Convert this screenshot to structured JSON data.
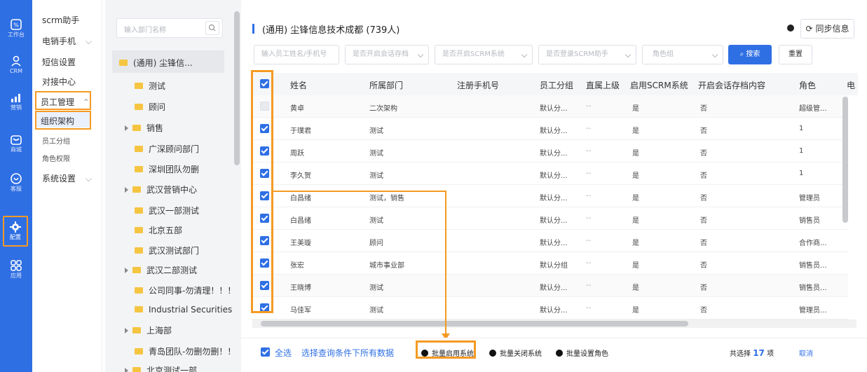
{
  "rail": {
    "items": [
      {
        "label": "工作台",
        "icon": "workbench-icon"
      },
      {
        "label": "CRM",
        "icon": "user-icon"
      },
      {
        "label": "营销",
        "icon": "marketing-icon"
      },
      {
        "label": "商城",
        "icon": "mall-icon"
      },
      {
        "label": "客服",
        "icon": "service-icon"
      },
      {
        "label": "配置",
        "icon": "gear-icon"
      },
      {
        "label": "应用",
        "icon": "apps-icon"
      }
    ]
  },
  "submenu": {
    "items": [
      "scrm助手",
      "电销手机",
      "短信设置",
      "对接中心",
      "员工管理",
      "组织架构",
      "员工分组",
      "角色权限",
      "系统设置"
    ]
  },
  "tree": {
    "search_placeholder": "输入部门名称",
    "root": "(通用) 尘锋信...",
    "nodes": [
      "测试",
      "顾问",
      "销售",
      "广深顾问部门",
      "深圳团队勿删",
      "武汉营销中心",
      "武汉一部测试",
      "北京五部",
      "武汉测试部门",
      "武汉二部测试",
      "公司同事-勿清理！！！",
      "Industrial Securities",
      "上海部",
      "青岛团队-勿删勿删！！",
      "北京测试一部"
    ]
  },
  "main": {
    "title": "(通用) 尘锋信息技术成都 (739人)",
    "sync_label": "同步信息",
    "filters": {
      "name_placeholder": "输入员工姓名/手机号",
      "archive": "是否开启会话存档",
      "scrm": "是否开启SCRM系统",
      "login": "是否登录SCRM助手",
      "role": "角色组"
    },
    "search_label": "搜索",
    "reset_label": "重置",
    "columns": [
      "姓名",
      "所属部门",
      "注册手机号",
      "员工分组",
      "直属上级",
      "启用SCRM系统",
      "开启会话存档内容",
      "角色",
      "电"
    ],
    "rows": [
      {
        "name": "黄卓",
        "dept": "二次架构",
        "group": "默认分...",
        "boss": "--",
        "scrm": "是",
        "archive": "否",
        "role": "超级管...",
        "checked": false
      },
      {
        "name": "于璞君",
        "dept": "测试",
        "group": "默认分...",
        "boss": "--",
        "scrm": "是",
        "archive": "否",
        "role": "1",
        "checked": true
      },
      {
        "name": "周跃",
        "dept": "测试",
        "group": "默认分...",
        "boss": "--",
        "scrm": "是",
        "archive": "否",
        "role": "1",
        "checked": true
      },
      {
        "name": "李久贺",
        "dept": "测试",
        "group": "默认分...",
        "boss": "--",
        "scrm": "是",
        "archive": "否",
        "role": "1",
        "checked": true
      },
      {
        "name": "白昌绪",
        "dept": "测试，销售",
        "group": "默认分...",
        "boss": "--",
        "scrm": "是",
        "archive": "否",
        "role": "管理员",
        "checked": true
      },
      {
        "name": "白昌绪",
        "dept": "测试",
        "group": "默认分...",
        "boss": "--",
        "scrm": "是",
        "archive": "否",
        "role": "销售员",
        "checked": true
      },
      {
        "name": "王美璇",
        "dept": "顾问",
        "group": "默认分...",
        "boss": "--",
        "scrm": "是",
        "archive": "否",
        "role": "合作商...",
        "checked": true
      },
      {
        "name": "张宏",
        "dept": "城市事业部",
        "group": "默认分组",
        "boss": "--",
        "scrm": "是",
        "archive": "否",
        "role": "销售员...",
        "checked": true
      },
      {
        "name": "王晓博",
        "dept": "测试",
        "group": "默认分...",
        "boss": "--",
        "scrm": "是",
        "archive": "否",
        "role": "销售员...",
        "checked": true
      },
      {
        "name": "马佳军",
        "dept": "测试",
        "group": "默认分...",
        "boss": "--",
        "scrm": "是",
        "archive": "否",
        "role": "管理员...",
        "checked": true
      }
    ]
  },
  "footer": {
    "select_all": "全选",
    "select_by_query": "选择查询条件下所有数据",
    "batch_enable": "批量启用系统",
    "batch_disable": "批量关闭系统",
    "batch_role": "批量设置角色",
    "selected_prefix": "共选择",
    "selected_count": "17",
    "selected_suffix": "项",
    "cancel": "取消"
  },
  "colors": {
    "primary": "#2f6fe4",
    "highlight": "#f59a23",
    "folder": "#f5c542"
  }
}
